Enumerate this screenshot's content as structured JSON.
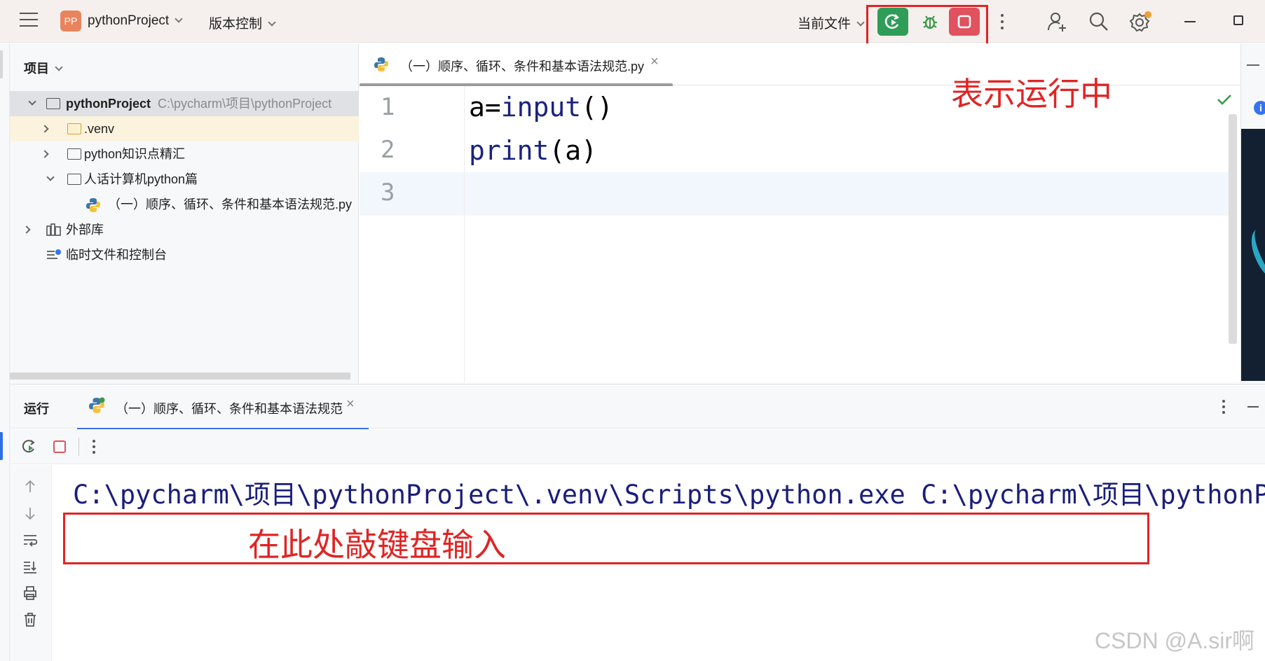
{
  "titlebar": {
    "project_badge": "PP",
    "project_name": "pythonProject",
    "vcs_label": "版本控制",
    "run_config": "当前文件",
    "icons": [
      "hamburger-icon",
      "rerun-icon",
      "debug-icon",
      "stop-icon",
      "more-icon",
      "add-user-icon",
      "search-icon",
      "settings-icon",
      "minimize-icon",
      "restore-icon"
    ]
  },
  "project_panel": {
    "title": "项目",
    "tree": [
      {
        "label": "pythonProject",
        "hint": "C:\\pycharm\\项目\\pythonProject",
        "level": 0,
        "expanded": true,
        "type": "folder"
      },
      {
        "label": ".venv",
        "level": 1,
        "expanded": false,
        "type": "folder-excluded"
      },
      {
        "label": "python知识点精汇",
        "level": 1,
        "expanded": false,
        "type": "folder"
      },
      {
        "label": "人话计算机python篇",
        "level": 1,
        "expanded": true,
        "type": "folder"
      },
      {
        "label": "（一）顺序、循环、条件和基本语法规范.py",
        "level": 2,
        "type": "python-file"
      },
      {
        "label": "外部库",
        "level": 0,
        "expanded": false,
        "type": "library"
      },
      {
        "label": "临时文件和控制台",
        "level": 0,
        "type": "scratches"
      }
    ]
  },
  "editor": {
    "tab_label": "（一）顺序、循环、条件和基本语法规范.py",
    "tab_close": "×",
    "lines": [
      {
        "no": "1",
        "text": "a=input()"
      },
      {
        "no": "2",
        "text": "print(a)"
      },
      {
        "no": "3",
        "text": ""
      }
    ],
    "annotation": "表示运行中"
  },
  "run_window": {
    "title": "运行",
    "tab_label": "（一）顺序、循环、条件和基本语法规范",
    "tab_close": "×",
    "console_command": "C:\\pycharm\\项目\\pythonProject\\.venv\\Scripts\\python.exe C:\\pycharm\\项目\\pythonProject\\人话计算机python篇\\（一）顺序、循环、条件和基本语法规范.py",
    "input_annotation": "在此处敲键盘输入"
  },
  "watermark": "CSDN @A.sir啊",
  "colors": {
    "annotation_red": "#e02424",
    "run_green": "#2f9d58",
    "stop_red": "#e0525e",
    "accent_blue": "#3574f0",
    "console_text": "#1a1e7a"
  }
}
